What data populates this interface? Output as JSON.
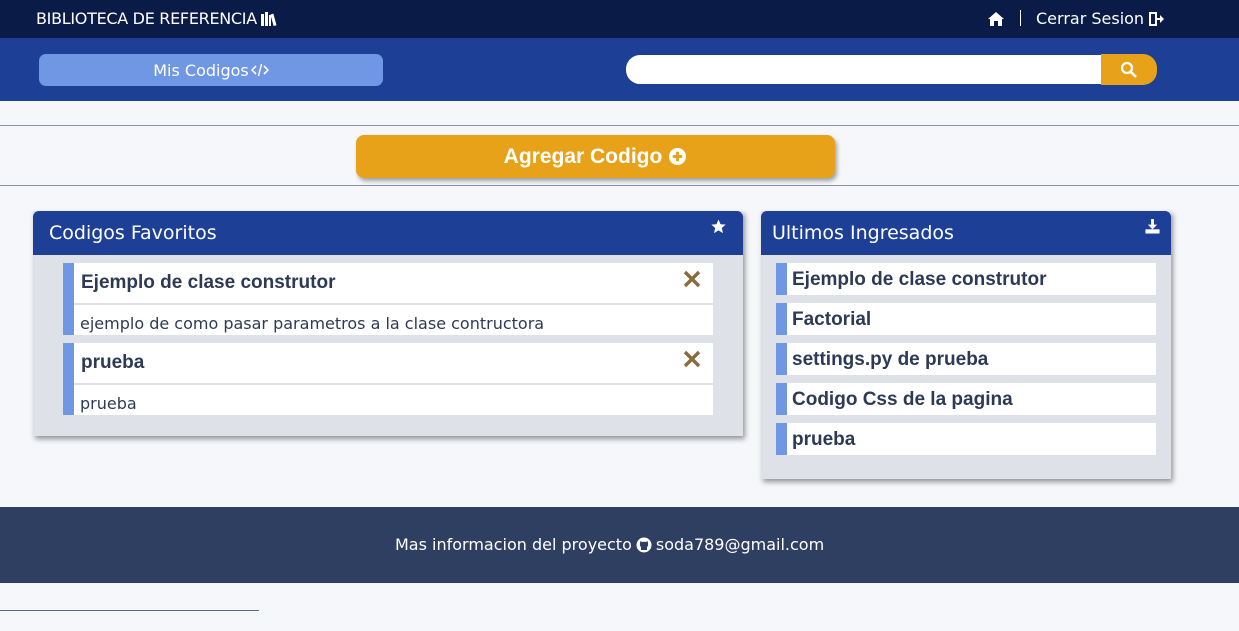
{
  "header": {
    "brand": "BIBLIOTECA DE REFERENCIA",
    "home_icon": "home-icon",
    "logout_label": "Cerrar Sesion"
  },
  "nav": {
    "my_codes_label": "Mis Codigos",
    "search_placeholder": "",
    "search_value": ""
  },
  "actions": {
    "add_label": "Agregar Codigo"
  },
  "favorites": {
    "title": "Codigos Favoritos",
    "items": [
      {
        "title": "Ejemplo de clase construtor",
        "description": "ejemplo de como pasar parametros a la clase contructora"
      },
      {
        "title": "prueba",
        "description": "prueba"
      }
    ]
  },
  "recent": {
    "title": "Ultimos Ingresados",
    "items": [
      {
        "title": "Ejemplo de clase construtor"
      },
      {
        "title": "Factorial"
      },
      {
        "title": "settings.py de prueba"
      },
      {
        "title": "Codigo Css de la pagina"
      },
      {
        "title": "prueba"
      }
    ]
  },
  "footer": {
    "text": "Mas informacion del proyecto",
    "email": "soda789@gmail.com"
  },
  "colors": {
    "topbar": "#0a1b47",
    "navbar": "#1d4096",
    "accent": "#e8a219",
    "light_blue": "#7097e3",
    "footer": "#2f3f61"
  }
}
